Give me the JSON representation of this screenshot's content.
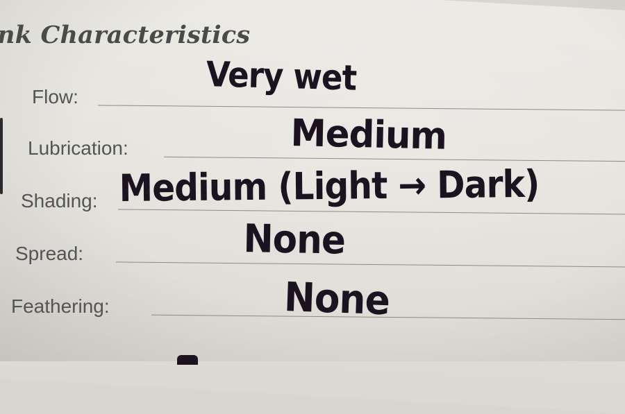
{
  "section": {
    "title": "nk Characteristics"
  },
  "fields": [
    {
      "key": "flow",
      "label": "Flow:",
      "value": "Very wet"
    },
    {
      "key": "lubrication",
      "label": "Lubrication:",
      "value": "Medium"
    },
    {
      "key": "shading",
      "label": "Shading:",
      "value": "Medium (Light → Dark)"
    },
    {
      "key": "spread",
      "label": "Spread:",
      "value": "None"
    },
    {
      "key": "feathering",
      "label": "Feathering:",
      "value": "None"
    }
  ],
  "colors": {
    "paper": "#e6e4de",
    "printed_text": "#545454",
    "ink": "#1b1420",
    "rule_line": "#8c8a86"
  }
}
